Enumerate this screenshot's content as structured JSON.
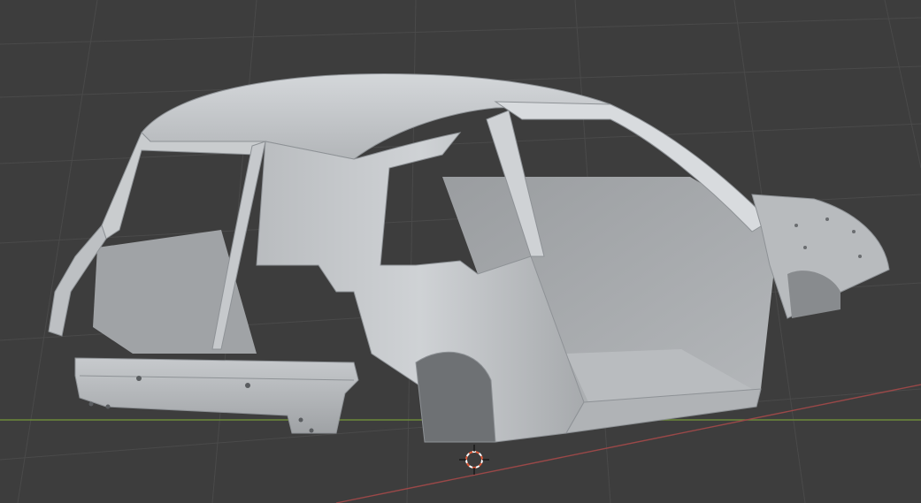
{
  "viewport": {
    "mode": "solid-shading",
    "background_color": "#3d3d3d",
    "grid_color": "#4a4a4a",
    "x_axis_color": "#9a4848",
    "y_axis_color": "#6c8a3a"
  },
  "object": {
    "kind": "car-body-shell",
    "body_color": "#c4c7ca",
    "shadow_color": "#8e9296",
    "interior_color": "#a3a6a9"
  },
  "cursor_3d": {
    "icon": "3d-cursor-icon",
    "ring_color_a": "#e25b3a",
    "ring_color_b": "#ffffff"
  }
}
